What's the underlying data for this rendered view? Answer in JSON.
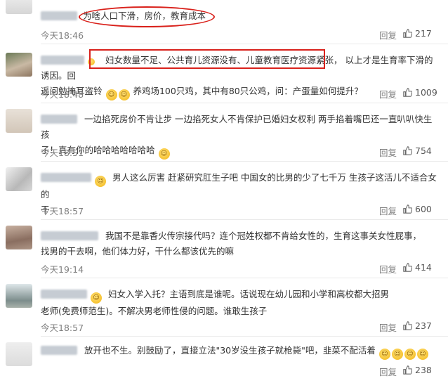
{
  "comments": [
    {
      "text": "为啥人口下滑，房价，教育成本",
      "time": "今天18:46",
      "reply": "回复",
      "likes": "217"
    },
    {
      "text_highlight": "妇女数量不足、公共育儿资源没有、儿童教育医疗资源紧张，",
      "text_rest": "以上才是生育率下滑的诱因。回",
      "line2a": "遥问勉掩耳盗铃",
      "line2b": "养鸡场100只鸡，其中有80只公鸡，问：产蛋量如何提升？",
      "time": "今天18:48",
      "reply": "回复",
      "likes": "1009"
    },
    {
      "line1": "一边掐死房价不肯让步 一边掐死女人不肯保护已婚妇女权利 两手掐着嘴巴还一直叭叭快生孩",
      "line2a": "子！真有你的哈哈哈哈哈哈哈",
      "time": "今天18:51",
      "reply": "回复",
      "likes": "754"
    },
    {
      "line1": "男人这么厉害 赶紧研究肛生子吧 中国女的比男的少了七千万 生孩子这活儿不适合女的",
      "line2": "干",
      "time": "今天18:57",
      "reply": "回复",
      "likes": "600"
    },
    {
      "line1": "我国不是靠香火传宗接代吗？连个冠姓权都不肯给女性的，生育这事关女性屁事，",
      "line2": "找男的干去啊，他们体力好，干什么都该优先的嘛",
      "time": "今天19:14",
      "reply": "回复",
      "likes": "414"
    },
    {
      "line1": "妇女入学入托？主语到底是谁呢。话说现在幼儿园和小学和高校都大招男",
      "line2": "老师(免费师范生)。不解决男老师性侵的问题。谁敢生孩子",
      "time": "今天18:57",
      "reply": "回复",
      "likes": "237"
    },
    {
      "line1": "放开也不生。别鼓励了，直接立法\"30岁没生孩子就枪毙\"吧，韭菜不配活着",
      "reply": "回复",
      "likes": "238"
    }
  ],
  "icons": {
    "like": "thumbs-up-icon",
    "emoji": "emoji-face-icon"
  },
  "colors": {
    "highlight": "#d9211b",
    "muted": "#808080"
  }
}
